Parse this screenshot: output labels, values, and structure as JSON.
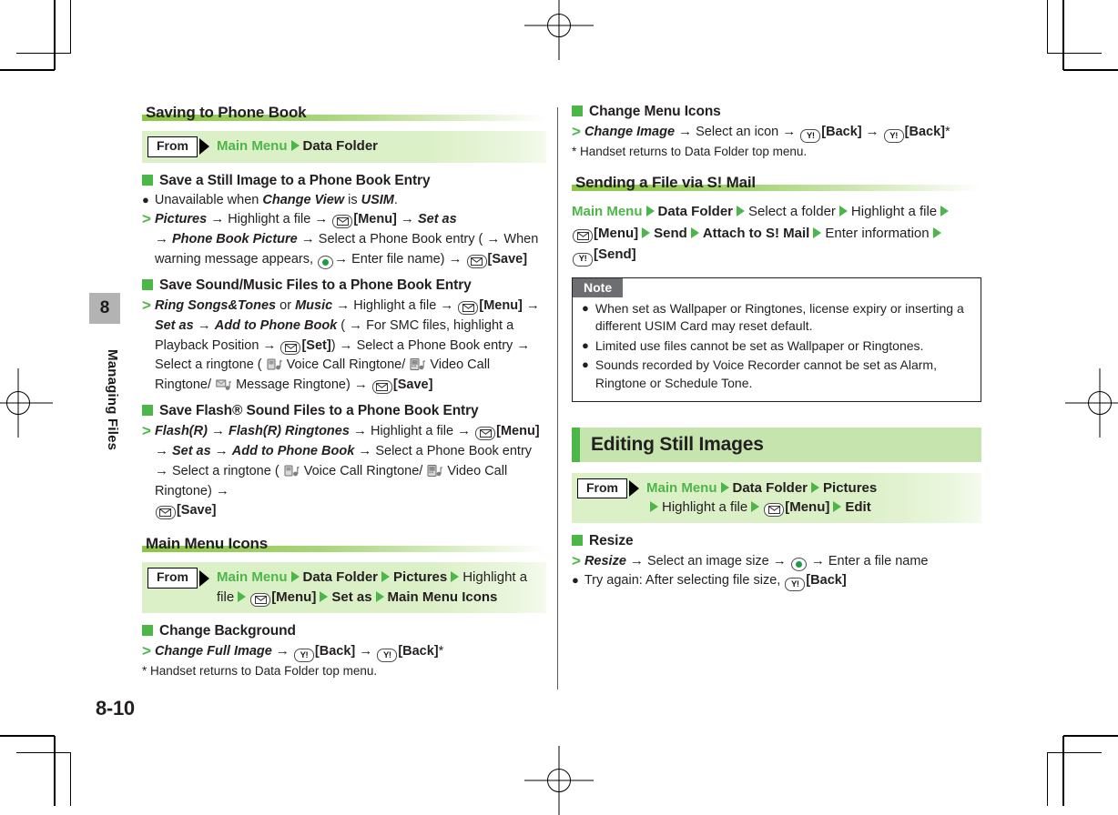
{
  "page": {
    "folio": "8-10",
    "chapter_number": "8",
    "chapter_name": "Managing Files"
  },
  "left_column": {
    "section1": {
      "heading": "Saving to Phone Book",
      "nav": {
        "from_label": "From",
        "steps": [
          {
            "text": "Main Menu",
            "style": "green"
          },
          {
            "text": "Data Folder",
            "style": "dark"
          }
        ]
      },
      "blocks": [
        {
          "sub_head": "Save a Still Image to a Phone Book Entry",
          "bullet": "Unavailable when Change View is USIM.",
          "step_html": "step1"
        },
        {
          "sub_head": "Save Sound/Music Files to a Phone Book Entry",
          "step_html": "step2"
        },
        {
          "sub_head": "Save Flash® Sound Files to a Phone Book Entry",
          "step_html": "step3"
        }
      ]
    },
    "section2": {
      "heading": "Main Menu Icons",
      "nav": {
        "from_label": "From",
        "steps": [
          {
            "text": "Main Menu",
            "style": "green"
          },
          {
            "text": "Data Folder",
            "style": "dark"
          },
          {
            "text": "Pictures",
            "style": "dark"
          },
          {
            "text": "Highlight a file",
            "style": "plain"
          },
          {
            "text": "[Menu]",
            "style": "key-mail"
          },
          {
            "text": "Set as",
            "style": "dark"
          },
          {
            "text": "Main Menu Icons",
            "style": "dark"
          }
        ]
      },
      "blocks": [
        {
          "sub_head": "Change Background",
          "step_html": "step4",
          "footnote": "* Handset returns to Data Folder top menu."
        }
      ]
    }
  },
  "right_column": {
    "block_change_menu_icons": {
      "sub_head": "Change Menu Icons",
      "step_html": "step5",
      "footnote": "* Handset returns to Data Folder top menu."
    },
    "section_smail": {
      "heading": "Sending a File via S! Mail",
      "path_steps": [
        {
          "text": "Main Menu",
          "style": "green"
        },
        {
          "text": "Data Folder",
          "style": "dark"
        },
        {
          "text": "Select a folder",
          "style": "plain"
        },
        {
          "text": "Highlight a file",
          "style": "plain"
        },
        {
          "text": "[Menu]",
          "style": "key-mail"
        },
        {
          "text": "Send",
          "style": "dark"
        },
        {
          "text": "Attach to S! Mail",
          "style": "dark"
        },
        {
          "text": "Enter information",
          "style": "plain"
        },
        {
          "text": "[Send]",
          "style": "key-yahoo"
        }
      ],
      "note": {
        "title": "Note",
        "items": [
          "When set as Wallpaper or Ringtones, license expiry or inserting a different USIM Card may reset default.",
          "Limited use files cannot be set as Wallpaper or Ringtones.",
          "Sounds recorded by Voice Recorder cannot be set as Alarm, Ringtone or Schedule Tone."
        ]
      }
    },
    "section_editing": {
      "heading": "Editing Still Images",
      "nav": {
        "from_label": "From",
        "steps": [
          {
            "text": "Main Menu",
            "style": "green"
          },
          {
            "text": "Data Folder",
            "style": "dark"
          },
          {
            "text": "Pictures",
            "style": "dark"
          },
          {
            "text": "Highlight a file",
            "style": "plain"
          },
          {
            "text": "[Menu]",
            "style": "key-mail"
          },
          {
            "text": "Edit",
            "style": "dark"
          }
        ]
      },
      "blocks": [
        {
          "sub_head": "Resize",
          "step_html": "step6",
          "bullet": "Try again: After selecting file size, [Back]"
        }
      ]
    }
  },
  "icons": {
    "mail_key": "envelope-key-icon",
    "yahoo_key": "yahoo-key-icon",
    "center_key": "center-select-key-icon",
    "voice_call_ringtone": "voice-call-ringtone-icon",
    "video_call_ringtone": "video-call-ringtone-icon",
    "message_ringtone": "message-ringtone-icon",
    "green_triangle": "green-triangle-icon",
    "green_square_bullet": "green-square-bullet-icon",
    "from_arrow": "from-arrow-icon",
    "registration_mark": "registration-target-icon",
    "crop_mark": "crop-mark-icon"
  },
  "colors": {
    "accent_green": "#4cb648",
    "band_green": "#c6e5ae",
    "nav_green": "#dcf0c8",
    "rule_green": "#8cc63f",
    "text": "#231f20",
    "note_tab_gray": "#6d6e71",
    "chapter_tab_gray": "#b3b3b3"
  }
}
